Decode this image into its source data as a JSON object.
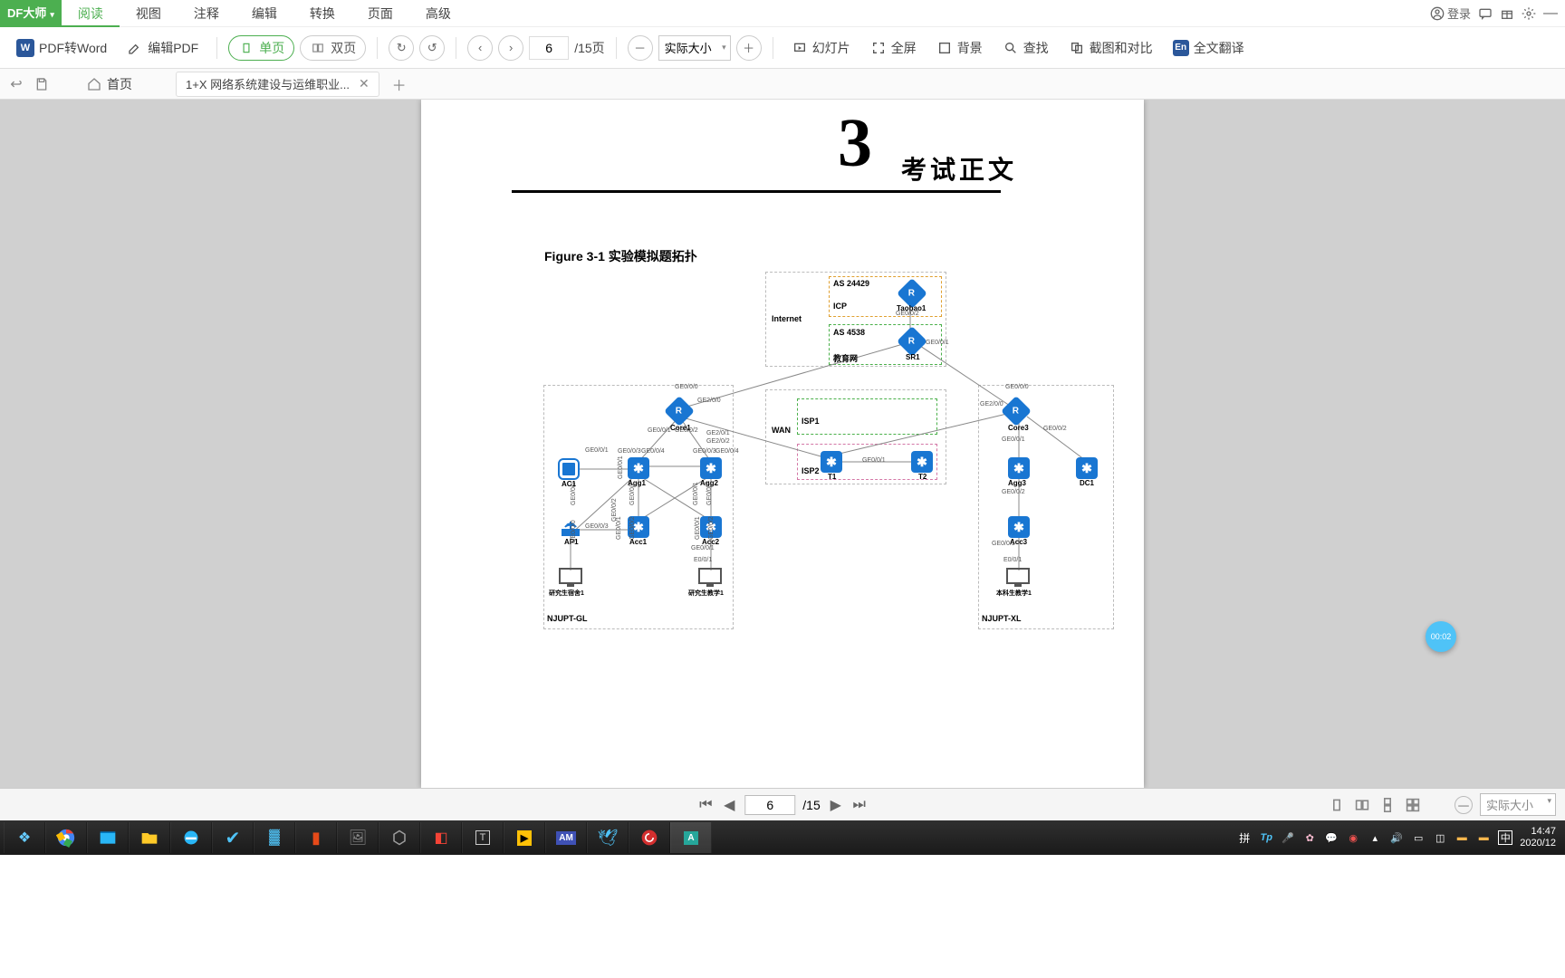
{
  "app_name": "DF大师",
  "main_tabs": [
    "阅读",
    "视图",
    "注释",
    "编辑",
    "转换",
    "页面",
    "高级"
  ],
  "login_label": "登录",
  "toolbar": {
    "pdf2word": "PDF转Word",
    "editpdf": "编辑PDF",
    "single": "单页",
    "double": "双页",
    "page_current": "6",
    "page_total": "/15页",
    "zoom": "实际大小",
    "slideshow": "幻灯片",
    "fullscreen": "全屏",
    "background": "背景",
    "find": "查找",
    "snip": "截图和对比",
    "fulltranslate": "全文翻译"
  },
  "doctabs": {
    "home": "首页",
    "doc": "1+X 网络系统建设与运维职业..."
  },
  "pdf": {
    "chapter_num": "3",
    "chapter_title": "考试正文",
    "fig_caption": "Figure 3-1 实验模拟题拓扑",
    "labels": {
      "internet": "Internet",
      "as24429": "AS 24429",
      "icp": "ICP",
      "as4538": "AS 4538",
      "edu": "教育网",
      "wan": "WAN",
      "isp1": "ISP1",
      "isp2": "ISP2",
      "njupt_gl": "NJUPT-GL",
      "njupt_xl": "NJUPT-XL",
      "taobao1": "Taobao1",
      "sr1": "SR1",
      "core1": "Core1",
      "core3": "Core3",
      "ac1": "AC1",
      "agg1": "Agg1",
      "agg2": "Agg2",
      "agg3": "Agg3",
      "acc1": "Acc1",
      "acc2": "Acc2",
      "acc3": "Acc3",
      "ap1": "AP1",
      "t1": "T1",
      "t2": "T2",
      "dc1": "DC1",
      "dorm1": "研究生宿舍1",
      "teach1": "研究生教学1",
      "teach2": "本科生教学1"
    }
  },
  "badge": "00:02",
  "bottombar": {
    "page": "6",
    "total": "/15",
    "zoom": "实际大小"
  },
  "tray": {
    "ime": "拼",
    "lang": "中",
    "time": "14:47",
    "date": "2020/12"
  }
}
